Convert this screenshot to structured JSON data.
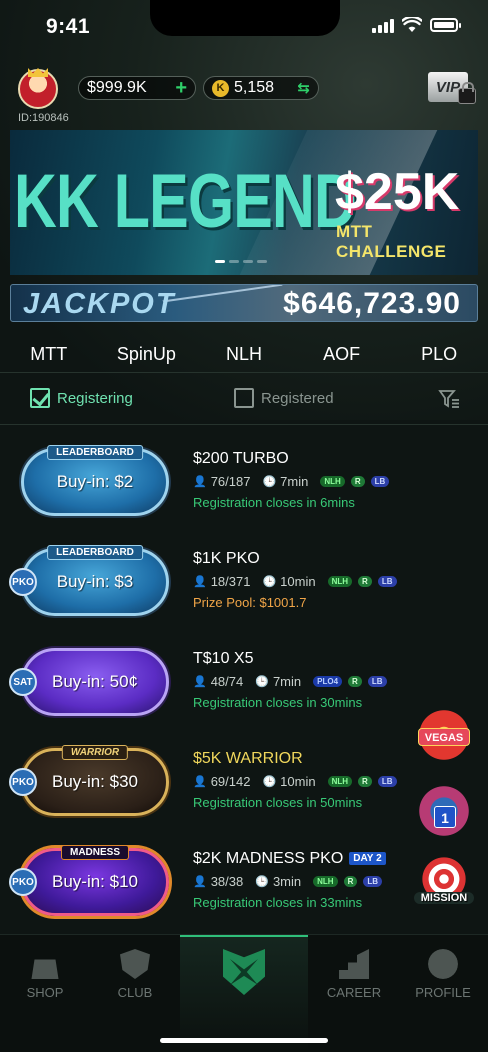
{
  "status": {
    "time": "9:41"
  },
  "user": {
    "id": "ID:190846",
    "cash": "$999.9K",
    "cash_add": "+",
    "coins": "5,158",
    "coin_symbol": "K",
    "coin_swap": "⇆",
    "vip": "VIP"
  },
  "banner": {
    "title": "KK LEGEND",
    "prize": "$25K",
    "subtitle": "MTT CHALLENGE"
  },
  "jackpot": {
    "label": "JACKPOT",
    "amount": "$646,723.90"
  },
  "tabs": [
    "MTT",
    "SpinUp",
    "NLH",
    "AOF",
    "PLO"
  ],
  "filters": {
    "registering": "Registering",
    "registered": "Registered",
    "registering_checked": true,
    "registered_checked": false
  },
  "tournaments": [
    {
      "button": "Buy-in: $2",
      "tag": "LEADERBOARD",
      "chip": "",
      "title": "$200 TURBO",
      "players": "76/187",
      "time": "7min",
      "tags": [
        "NLH",
        "R",
        "LB"
      ],
      "status": "Registration closes in 6mins"
    },
    {
      "button": "Buy-in: $3",
      "tag": "LEADERBOARD",
      "chip": "PKO",
      "title": "$1K PKO",
      "players": "18/371",
      "time": "10min",
      "tags": [
        "NLH",
        "R",
        "LB"
      ],
      "status": "Prize Pool: $1001.7"
    },
    {
      "button": "Buy-in: 50¢",
      "tag": "",
      "chip": "SAT",
      "title": "T$10 X5",
      "players": "48/74",
      "time": "7min",
      "tags": [
        "PLO4",
        "R",
        "LB"
      ],
      "status": "Registration closes in 30mins"
    },
    {
      "button": "Buy-in: $30",
      "tag": "WARRIOR",
      "chip": "PKO",
      "title": "$5K WARRIOR",
      "players": "69/142",
      "time": "10min",
      "tags": [
        "NLH",
        "R",
        "LB"
      ],
      "status": "Registration closes in 50mins"
    },
    {
      "button": "Buy-in: $10",
      "tag": "MADNESS",
      "chip": "PKO",
      "title": "$2K MADNESS PKO",
      "day": "DAY 2",
      "players": "38/38",
      "time": "3min",
      "tags": [
        "NLH",
        "R",
        "LB"
      ],
      "status": "Registration closes in 33mins"
    }
  ],
  "side_badges": {
    "vegas": "VEGAS",
    "stack_number": "1",
    "mission": "MISSION"
  },
  "nav": {
    "shop": "SHOP",
    "club": "CLUB",
    "career": "CAREER",
    "profile": "PROFILE"
  },
  "colors": {
    "accent_green": "#38c977",
    "prize_orange": "#f0a548",
    "title_gold": "#f0d75c"
  }
}
